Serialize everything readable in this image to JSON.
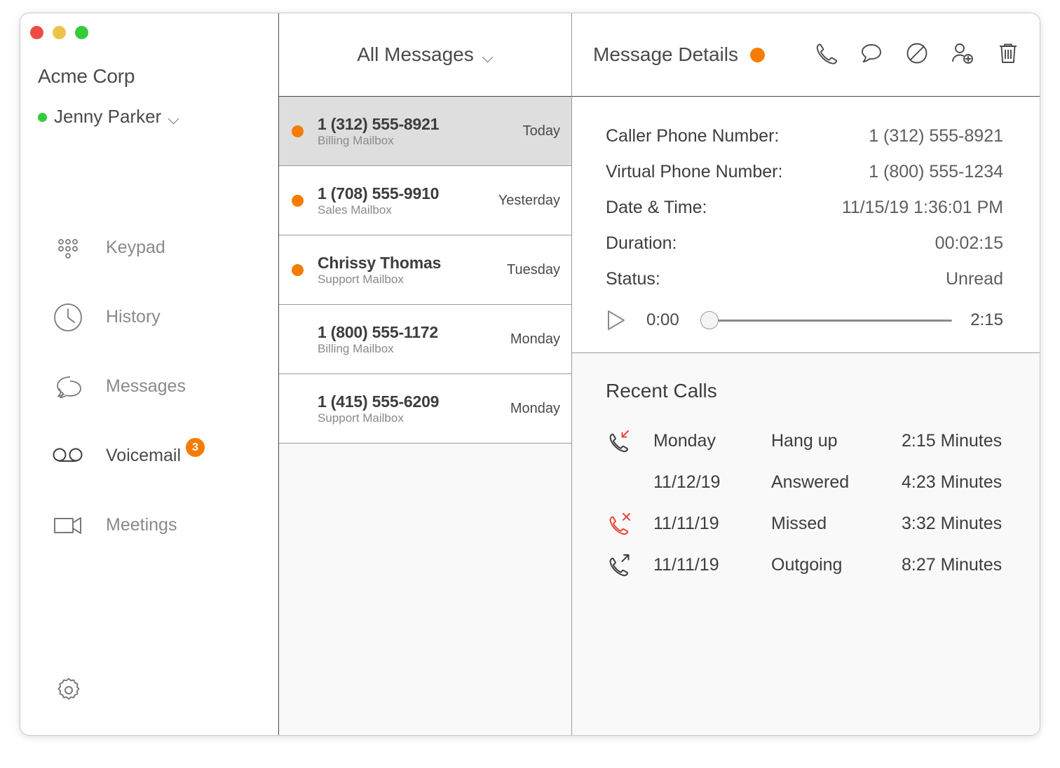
{
  "window": {
    "traffic_lights": [
      "close",
      "minimize",
      "maximize"
    ],
    "colors": {
      "accent_orange": "#F57C00",
      "missed_red": "#E8463C",
      "presence_green": "#35CC3B",
      "text_dark": "#3D3D3D",
      "text_muted": "#8A8A8A"
    }
  },
  "sidebar": {
    "org_title": "Acme Corp",
    "user": {
      "name": "Jenny Parker",
      "presence": "available",
      "chevron": "chevron-down-icon"
    },
    "nav_items": [
      {
        "label": "Keypad",
        "icon": "keypad-icon",
        "active": false,
        "badge": ""
      },
      {
        "label": "History",
        "icon": "clock-icon",
        "active": false,
        "badge": ""
      },
      {
        "label": "Messages",
        "icon": "chat-icon",
        "active": false,
        "badge": ""
      },
      {
        "label": "Voicemail",
        "icon": "voicemail-icon",
        "active": true,
        "badge": "3"
      },
      {
        "label": "Meetings",
        "icon": "video-icon",
        "active": false,
        "badge": ""
      }
    ],
    "settings": {
      "label": "Settings",
      "icon": "gear-icon"
    }
  },
  "message_list": {
    "header": {
      "title": "All Messages",
      "chevron": "chevron-down-icon"
    },
    "rows": [
      {
        "primary": "1 (312) 555-8921",
        "secondary": "Billing Mailbox",
        "time": "Today",
        "unread": true,
        "selected": true
      },
      {
        "primary": "1 (708) 555-9910",
        "secondary": "Sales Mailbox",
        "time": "Yesterday",
        "unread": true,
        "selected": false
      },
      {
        "primary": "Chrissy Thomas",
        "secondary": "Support Mailbox",
        "time": "Tuesday",
        "unread": true,
        "selected": false
      },
      {
        "primary": "1 (800) 555-1172",
        "secondary": "Billing Mailbox",
        "time": "Monday",
        "unread": false,
        "selected": false
      },
      {
        "primary": "1 (415) 555-6209",
        "secondary": "Support Mailbox",
        "time": "Monday",
        "unread": false,
        "selected": false
      }
    ]
  },
  "details": {
    "header": {
      "title": "Message Details",
      "status_dot": "unread-dot"
    },
    "toolbar": [
      {
        "name": "call-button",
        "icon": "phone-icon",
        "label": "Call"
      },
      {
        "name": "message-button",
        "icon": "chat-bubble-icon",
        "label": "Message"
      },
      {
        "name": "block-button",
        "icon": "block-icon",
        "label": "Block"
      },
      {
        "name": "add-contact-button",
        "icon": "add-user-icon",
        "label": "Add Contact"
      },
      {
        "name": "delete-button",
        "icon": "trash-icon",
        "label": "Delete"
      }
    ],
    "fields": [
      {
        "label": "Caller Phone Number:",
        "value": "1 (312) 555-8921"
      },
      {
        "label": "Virtual Phone Number:",
        "value": "1 (800) 555-1234"
      },
      {
        "label": "Date & Time:",
        "value": "11/15/19 1:36:01 PM"
      },
      {
        "label": "Duration:",
        "value": "00:02:15"
      },
      {
        "label": "Status:",
        "value": "Unread"
      }
    ],
    "player": {
      "play_icon": "play-icon",
      "elapsed": "0:00",
      "total": "2:15",
      "progress_percent": 0
    }
  },
  "recent_calls": {
    "title": "Recent Calls",
    "columns": [
      "date",
      "status",
      "duration"
    ],
    "rows": [
      {
        "icon": "incoming-call-icon",
        "date": "Monday",
        "status": "Hang up",
        "duration": "2:15 Minutes"
      },
      {
        "icon": "none",
        "date": "11/12/19",
        "status": "Answered",
        "duration": "4:23 Minutes"
      },
      {
        "icon": "missed-call-icon",
        "date": "11/11/19",
        "status": "Missed",
        "duration": "3:32 Minutes"
      },
      {
        "icon": "outgoing-call-icon",
        "date": "11/11/19",
        "status": "Outgoing",
        "duration": "8:27 Minutes"
      }
    ]
  }
}
